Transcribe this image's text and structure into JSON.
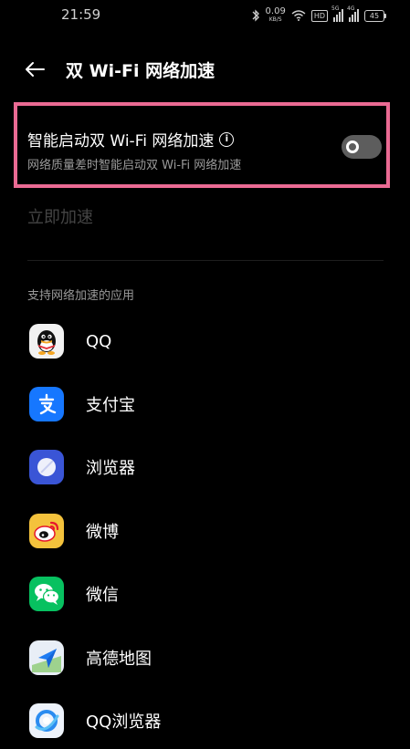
{
  "status_bar": {
    "time": "21:59",
    "net_speed_value": "0.09",
    "net_speed_unit": "KB/S",
    "hd_label": "HD",
    "sig1_label": "5G",
    "sig2_label": "4G",
    "battery": "45"
  },
  "header": {
    "title": "双 Wi-Fi 网络加速"
  },
  "smart_toggle": {
    "title": "智能启动双 Wi-Fi 网络加速",
    "subtitle": "网络质量差时智能启动双 Wi-Fi 网络加速",
    "enabled": false
  },
  "instant_accelerate": "立即加速",
  "section_label": "支持网络加速的应用",
  "apps": [
    {
      "name": "QQ",
      "icon": "qq-icon",
      "color": "#f2f2f2"
    },
    {
      "name": "支付宝",
      "icon": "alipay-icon",
      "color": "#1677ff"
    },
    {
      "name": "浏览器",
      "icon": "browser-icon",
      "color": "#3a55d6"
    },
    {
      "name": "微博",
      "icon": "weibo-icon",
      "color": "#f4c23c"
    },
    {
      "name": "微信",
      "icon": "wechat-icon",
      "color": "#07c160"
    },
    {
      "name": "高德地图",
      "icon": "amap-icon",
      "color": "#e8eef6"
    },
    {
      "name": "QQ浏览器",
      "icon": "qq-browser-icon",
      "color": "#eef3fb"
    }
  ],
  "colors": {
    "highlight": "#ea6a93",
    "switch_off": "#5d5d5d"
  }
}
